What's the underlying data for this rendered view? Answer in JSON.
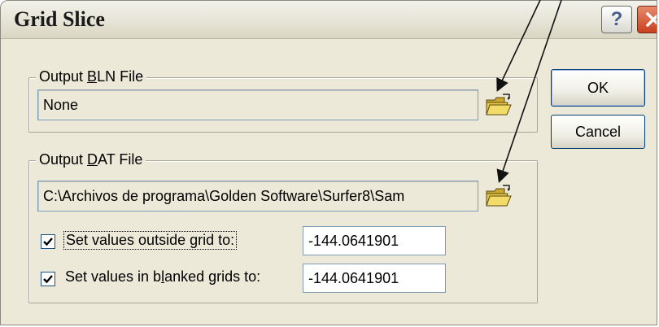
{
  "window": {
    "title": "Grid Slice",
    "help_glyph": "?",
    "close_icon": "close-x-icon"
  },
  "bln_group": {
    "legend_pre": "Output ",
    "legend_key": "B",
    "legend_post": "LN File",
    "file_value": "None",
    "browse_icon": "open-folder-icon"
  },
  "dat_group": {
    "legend_pre": "Output ",
    "legend_key": "D",
    "legend_post": "AT File",
    "file_value": "C:\\Archivos de programa\\Golden Software\\Surfer8\\Sam",
    "browse_icon": "open-folder-icon",
    "outside": {
      "checked": true,
      "label_pre": "Set values outside ",
      "label_key": "g",
      "label_post": "rid to:",
      "value": "-144.0641901"
    },
    "blanked": {
      "checked": true,
      "label_pre": "Set values in b",
      "label_key": "l",
      "label_post": "anked grids to:",
      "value": "-144.0641901"
    }
  },
  "buttons": {
    "ok": "OK",
    "cancel": "Cancel"
  },
  "colors": {
    "dialog_bg": "#ece9d8",
    "close_button": "#c8401e",
    "folder_yellow": "#e8c84a"
  }
}
